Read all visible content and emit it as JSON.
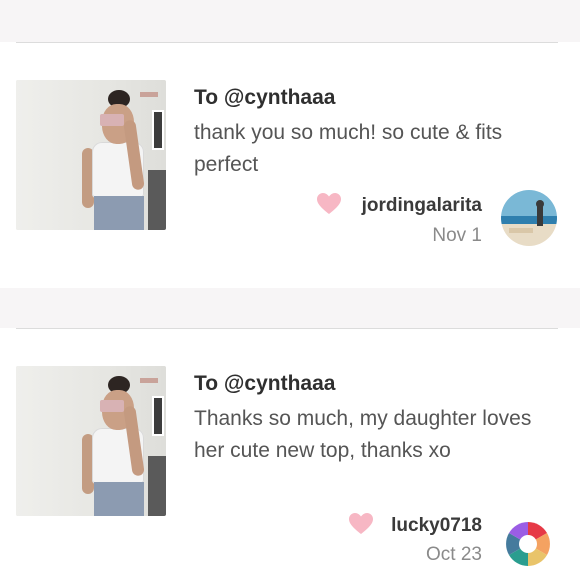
{
  "comments": [
    {
      "title": "To @cynthaaa",
      "message": "thank you so much! so cute & fits perfect",
      "username": "jordingalarita",
      "date": "Nov 1",
      "heart_color": "#f7b7c4"
    },
    {
      "title": "To @cynthaaa",
      "message": "Thanks so much, my daughter loves her cute new top, thanks xo",
      "username": "lucky0718",
      "date": "Oct 23",
      "heart_color": "#f7b7c4"
    }
  ]
}
